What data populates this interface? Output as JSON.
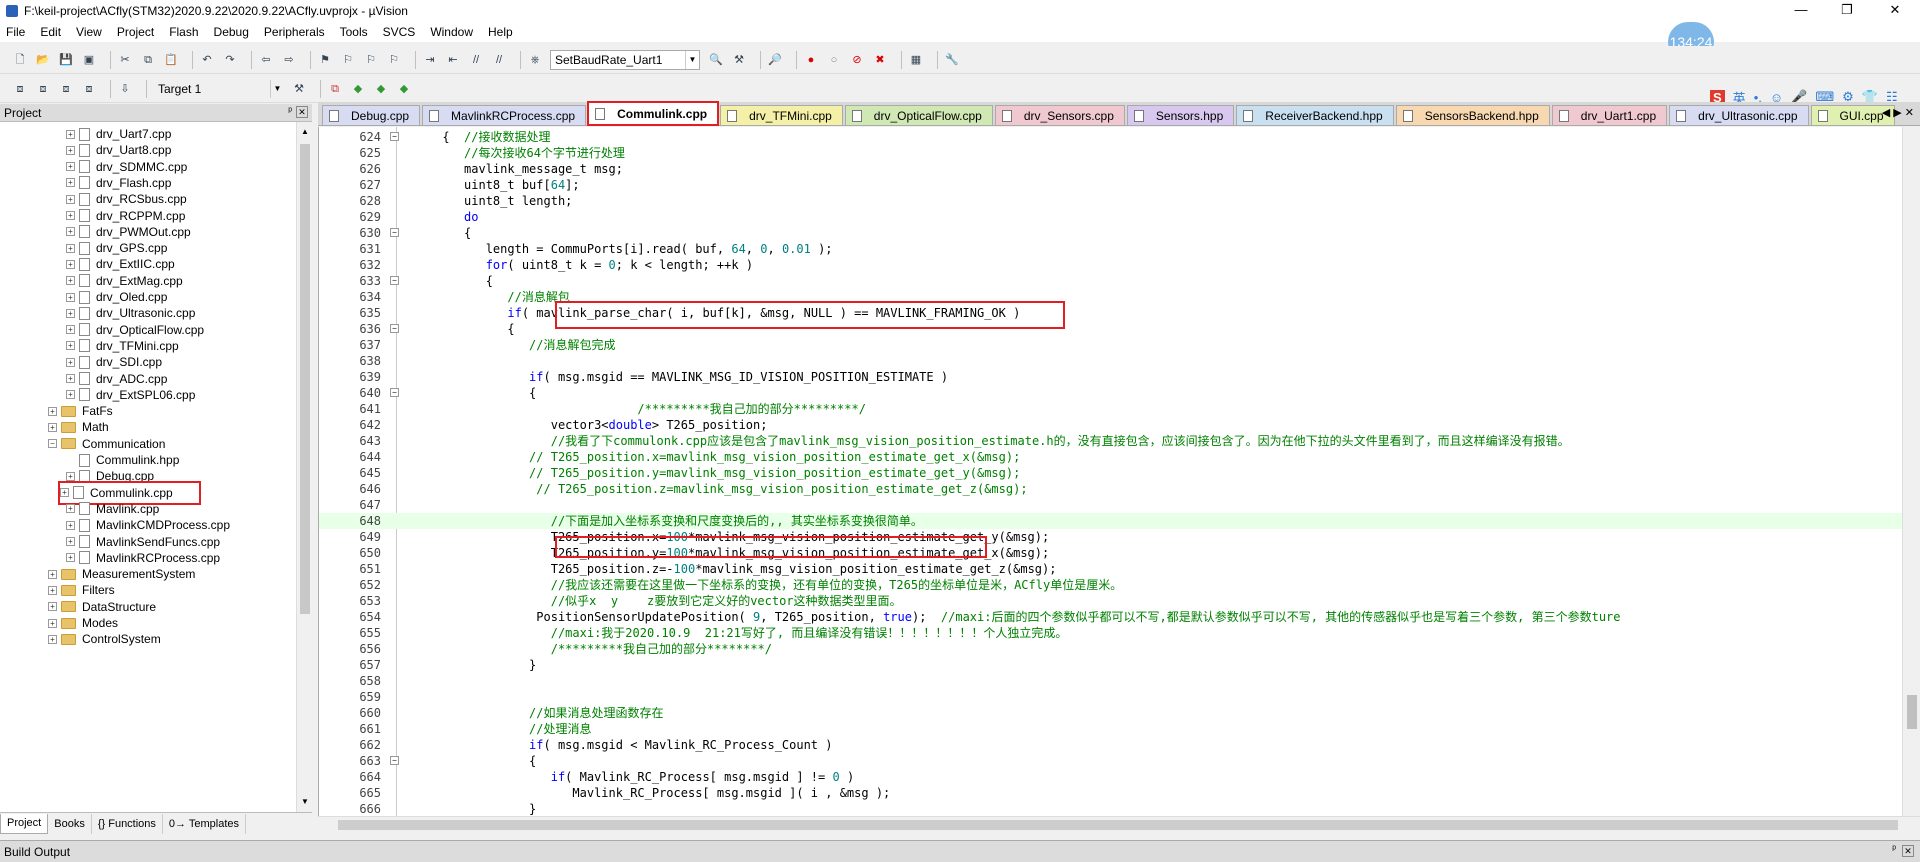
{
  "window": {
    "title": "F:\\keil-project\\ACfly(STM32)2020.9.22\\2020.9.22\\ACfly.uvprojx - µVision",
    "minimize": "—",
    "maximize": "❐",
    "close": "✕"
  },
  "clock": "134:24",
  "menu": [
    "File",
    "Edit",
    "View",
    "Project",
    "Flash",
    "Debug",
    "Peripherals",
    "Tools",
    "SVCS",
    "Window",
    "Help"
  ],
  "toolbar": {
    "find_combo_value": "SetBaudRate_Uart1",
    "target_combo_value": "Target 1"
  },
  "ime": [
    "S",
    "英",
    "•,",
    "☺",
    "🎤",
    "⌨",
    "⚙",
    "👕",
    "☷"
  ],
  "project_panel": {
    "title": "Project",
    "pin": "ᵖ",
    "close": "✕",
    "items": [
      {
        "label": "drv_Uart7.cpp",
        "type": "file",
        "level": 2
      },
      {
        "label": "drv_Uart8.cpp",
        "type": "file",
        "level": 2
      },
      {
        "label": "drv_SDMMC.cpp",
        "type": "file",
        "level": 2
      },
      {
        "label": "drv_Flash.cpp",
        "type": "file",
        "level": 2
      },
      {
        "label": "drv_RCSbus.cpp",
        "type": "file",
        "level": 2
      },
      {
        "label": "drv_RCPPM.cpp",
        "type": "file",
        "level": 2
      },
      {
        "label": "drv_PWMOut.cpp",
        "type": "file",
        "level": 2
      },
      {
        "label": "drv_GPS.cpp",
        "type": "file",
        "level": 2
      },
      {
        "label": "drv_ExtIIC.cpp",
        "type": "file",
        "level": 2
      },
      {
        "label": "drv_ExtMag.cpp",
        "type": "file",
        "level": 2
      },
      {
        "label": "drv_Oled.cpp",
        "type": "file",
        "level": 2
      },
      {
        "label": "drv_Ultrasonic.cpp",
        "type": "file",
        "level": 2
      },
      {
        "label": "drv_OpticalFlow.cpp",
        "type": "file",
        "level": 2
      },
      {
        "label": "drv_TFMini.cpp",
        "type": "file",
        "level": 2
      },
      {
        "label": "drv_SDI.cpp",
        "type": "file",
        "level": 2
      },
      {
        "label": "drv_ADC.cpp",
        "type": "file",
        "level": 2
      },
      {
        "label": "drv_ExtSPL06.cpp",
        "type": "file",
        "level": 2
      },
      {
        "label": "FatFs",
        "type": "folder",
        "level": 1,
        "expander": "+"
      },
      {
        "label": "Math",
        "type": "folder",
        "level": 1,
        "expander": "+"
      },
      {
        "label": "Communication",
        "type": "folder",
        "level": 1,
        "expander": "−"
      },
      {
        "label": "Commulink.hpp",
        "type": "file",
        "level": 2,
        "noexp": true
      },
      {
        "label": "Debug.cpp",
        "type": "file",
        "level": 2
      },
      {
        "label": "Commulink.cpp",
        "type": "file",
        "level": 2,
        "selected": true
      },
      {
        "label": "Mavlink.cpp",
        "type": "file",
        "level": 2
      },
      {
        "label": "MavlinkCMDProcess.cpp",
        "type": "file",
        "level": 2
      },
      {
        "label": "MavlinkSendFuncs.cpp",
        "type": "file",
        "level": 2
      },
      {
        "label": "MavlinkRCProcess.cpp",
        "type": "file",
        "level": 2
      },
      {
        "label": "MeasurementSystem",
        "type": "folder",
        "level": 1,
        "expander": "+"
      },
      {
        "label": "Filters",
        "type": "folder",
        "level": 1,
        "expander": "+"
      },
      {
        "label": "DataStructure",
        "type": "folder",
        "level": 1,
        "expander": "+"
      },
      {
        "label": "Modes",
        "type": "folder",
        "level": 1,
        "expander": "+"
      },
      {
        "label": "ControlSystem",
        "type": "folder",
        "level": 1,
        "expander": "+"
      }
    ],
    "bottom_tabs": [
      "Project",
      "Books",
      "{} Functions",
      "0→ Templates"
    ]
  },
  "editor_tabs": [
    {
      "label": "Debug.cpp",
      "color": "#d7dcf2"
    },
    {
      "label": "MavlinkRCProcess.cpp",
      "color": "#d7dcf2"
    },
    {
      "label": "Commulink.cpp",
      "color": "#ffffff",
      "active": true
    },
    {
      "label": "drv_TFMini.cpp",
      "color": "#f4f0a8"
    },
    {
      "label": "drv_OpticalFlow.cpp",
      "color": "#cfe8b4"
    },
    {
      "label": "drv_Sensors.cpp",
      "color": "#f0c8d0"
    },
    {
      "label": "Sensors.hpp",
      "color": "#d8c8f0"
    },
    {
      "label": "ReceiverBackend.hpp",
      "color": "#c8e0f0"
    },
    {
      "label": "SensorsBackend.hpp",
      "color": "#f8d8b0"
    },
    {
      "label": "drv_Uart1.cpp",
      "color": "#f0c8d0"
    },
    {
      "label": "drv_Ultrasonic.cpp",
      "color": "#d7dcf2"
    },
    {
      "label": "GUI.cpp",
      "color": "#e0f0b0"
    }
  ],
  "code_lines": [
    {
      "n": "624",
      "fold": "−",
      "t": "      {  ",
      "s": [
        [
          "tx",
          "      {  "
        ],
        [
          "cm",
          "//接收数据处理"
        ]
      ]
    },
    {
      "n": "625",
      "s": [
        [
          "tx",
          "         "
        ],
        [
          "cm",
          "//每次接收64个字节进行处理"
        ]
      ]
    },
    {
      "n": "626",
      "s": [
        [
          "tx",
          "         mavlink_message_t msg;"
        ]
      ]
    },
    {
      "n": "627",
      "s": [
        [
          "tx",
          "         uint8_t buf["
        ],
        [
          "nm",
          "64"
        ],
        [
          "tx",
          "];"
        ]
      ]
    },
    {
      "n": "628",
      "s": [
        [
          "tx",
          "         uint8_t length;"
        ]
      ]
    },
    {
      "n": "629",
      "s": [
        [
          "tx",
          "         "
        ],
        [
          "kw",
          "do"
        ]
      ]
    },
    {
      "n": "630",
      "fold": "−",
      "s": [
        [
          "tx",
          "         {"
        ]
      ]
    },
    {
      "n": "631",
      "s": [
        [
          "tx",
          "            length = CommuPorts[i].read( buf, "
        ],
        [
          "nm",
          "64"
        ],
        [
          "tx",
          ", "
        ],
        [
          "nm",
          "0"
        ],
        [
          "tx",
          ", "
        ],
        [
          "nm",
          "0.01"
        ],
        [
          "tx",
          " );"
        ]
      ]
    },
    {
      "n": "632",
      "s": [
        [
          "tx",
          "            "
        ],
        [
          "kw",
          "for"
        ],
        [
          "tx",
          "( uint8_t k = "
        ],
        [
          "nm",
          "0"
        ],
        [
          "tx",
          "; k < length; ++k )"
        ]
      ]
    },
    {
      "n": "633",
      "fold": "−",
      "s": [
        [
          "tx",
          "            {"
        ]
      ]
    },
    {
      "n": "634",
      "s": [
        [
          "tx",
          "               "
        ],
        [
          "cm",
          "//消息解包"
        ]
      ]
    },
    {
      "n": "635",
      "s": [
        [
          "tx",
          "               "
        ],
        [
          "kw",
          "if"
        ],
        [
          "tx",
          "( mavlink_parse_char( i, buf[k], &msg, NULL ) == MAVLINK_FRAMING_OK )"
        ]
      ]
    },
    {
      "n": "636",
      "fold": "−",
      "s": [
        [
          "tx",
          "               {"
        ]
      ]
    },
    {
      "n": "637",
      "s": [
        [
          "tx",
          "                  "
        ],
        [
          "cm",
          "//消息解包完成"
        ]
      ]
    },
    {
      "n": "638",
      "s": [
        [
          "tx",
          ""
        ]
      ]
    },
    {
      "n": "639",
      "s": [
        [
          "tx",
          "                  "
        ],
        [
          "kw",
          "if"
        ],
        [
          "tx",
          "( msg.msgid == MAVLINK_MSG_ID_VISION_POSITION_ESTIMATE )"
        ]
      ]
    },
    {
      "n": "640",
      "fold": "−",
      "s": [
        [
          "tx",
          "                  {"
        ]
      ]
    },
    {
      "n": "641",
      "s": [
        [
          "tx",
          "                                 "
        ],
        [
          "cm",
          "/*********我自己加的部分*********/"
        ]
      ]
    },
    {
      "n": "642",
      "s": [
        [
          "tx",
          "                     vector3<"
        ],
        [
          "kw",
          "double"
        ],
        [
          "tx",
          "> T265_position;"
        ]
      ]
    },
    {
      "n": "643",
      "s": [
        [
          "tx",
          "                     "
        ],
        [
          "cm",
          "//我看了下commulonk.cpp应该是包含了mavlink_msg_vision_position_estimate.h的，没有直接包含，应该间接包含了。因为在他下拉的头文件里看到了，而且这样编译没有报错。"
        ]
      ]
    },
    {
      "n": "644",
      "s": [
        [
          "tx",
          "                  "
        ],
        [
          "cm",
          "// T265_position.x=mavlink_msg_vision_position_estimate_get_x(&msg);"
        ]
      ]
    },
    {
      "n": "645",
      "s": [
        [
          "tx",
          "                  "
        ],
        [
          "cm",
          "// T265_position.y=mavlink_msg_vision_position_estimate_get_y(&msg);"
        ]
      ]
    },
    {
      "n": "646",
      "s": [
        [
          "tx",
          "                   "
        ],
        [
          "cm",
          "// T265_position.z=mavlink_msg_vision_position_estimate_get_z(&msg);"
        ]
      ]
    },
    {
      "n": "647",
      "s": [
        [
          "tx",
          ""
        ]
      ]
    },
    {
      "n": "648",
      "hl": true,
      "s": [
        [
          "tx",
          "                     "
        ],
        [
          "cm",
          "//下面是加入坐标系变换和尺度变换后的,, 其实坐标系变换很简单。"
        ]
      ]
    },
    {
      "n": "649",
      "s": [
        [
          "tx",
          "                     T265_position.x="
        ],
        [
          "nm",
          "100"
        ],
        [
          "tx",
          "*mavlink_msg_vision_position_estimate_get_y(&msg);"
        ]
      ]
    },
    {
      "n": "650",
      "s": [
        [
          "tx",
          "                     T265_position.y="
        ],
        [
          "nm",
          "100"
        ],
        [
          "tx",
          "*mavlink_msg_vision_position_estimate_get_x(&msg);"
        ]
      ]
    },
    {
      "n": "651",
      "s": [
        [
          "tx",
          "                     T265_position.z=-"
        ],
        [
          "nm",
          "100"
        ],
        [
          "tx",
          "*mavlink_msg_vision_position_estimate_get_z(&msg);"
        ]
      ]
    },
    {
      "n": "652",
      "s": [
        [
          "tx",
          "                     "
        ],
        [
          "cm",
          "//我应该还需要在这里做一下坐标系的变换，还有单位的变换，T265的坐标单位是米，ACfly单位是厘米。"
        ]
      ]
    },
    {
      "n": "653",
      "s": [
        [
          "tx",
          "                     "
        ],
        [
          "cm",
          "//似乎x  y    z要放到它定义好的vector这种数据类型里面。"
        ]
      ]
    },
    {
      "n": "654",
      "s": [
        [
          "tx",
          "                   PositionSensorUpdatePosition( "
        ],
        [
          "nm",
          "9"
        ],
        [
          "tx",
          ", T265_position, "
        ],
        [
          "kw",
          "true"
        ],
        [
          "tx",
          ");  "
        ],
        [
          "cm",
          "//maxi:后面的四个参数似乎都可以不写,都是默认参数似乎可以不写, 其他的传感器似乎也是写着三个参数, 第三个参数ture"
        ]
      ]
    },
    {
      "n": "655",
      "s": [
        [
          "tx",
          "                     "
        ],
        [
          "cm",
          "//maxi:我于2020.10.9  21:21写好了, 而且编译没有错误！！！！！！！！个人独立完成。"
        ]
      ]
    },
    {
      "n": "656",
      "s": [
        [
          "tx",
          "                     "
        ],
        [
          "cm",
          "/*********我自己加的部分********/"
        ]
      ]
    },
    {
      "n": "657",
      "s": [
        [
          "tx",
          "                  }"
        ]
      ]
    },
    {
      "n": "658",
      "s": [
        [
          "tx",
          ""
        ]
      ]
    },
    {
      "n": "659",
      "s": [
        [
          "tx",
          ""
        ]
      ]
    },
    {
      "n": "660",
      "s": [
        [
          "tx",
          "                  "
        ],
        [
          "cm",
          "//如果消息处理函数存在"
        ]
      ]
    },
    {
      "n": "661",
      "s": [
        [
          "tx",
          "                  "
        ],
        [
          "cm",
          "//处理消息"
        ]
      ]
    },
    {
      "n": "662",
      "s": [
        [
          "tx",
          "                  "
        ],
        [
          "kw",
          "if"
        ],
        [
          "tx",
          "( msg.msgid < Mavlink_RC_Process_Count )"
        ]
      ]
    },
    {
      "n": "663",
      "fold": "−",
      "s": [
        [
          "tx",
          "                  {"
        ]
      ]
    },
    {
      "n": "664",
      "s": [
        [
          "tx",
          "                     "
        ],
        [
          "kw",
          "if"
        ],
        [
          "tx",
          "( Mavlink_RC_Process[ msg.msgid ] != "
        ],
        [
          "nm",
          "0"
        ],
        [
          "tx",
          " )"
        ]
      ]
    },
    {
      "n": "665",
      "s": [
        [
          "tx",
          "                        Mavlink_RC_Process[ msg.msgid ]( i , &msg );"
        ]
      ]
    },
    {
      "n": "666",
      "s": [
        [
          "tx",
          "                  }"
        ]
      ]
    }
  ],
  "build_output": {
    "title": "Build Output",
    "pin": "ᵖ",
    "close": "✕"
  }
}
